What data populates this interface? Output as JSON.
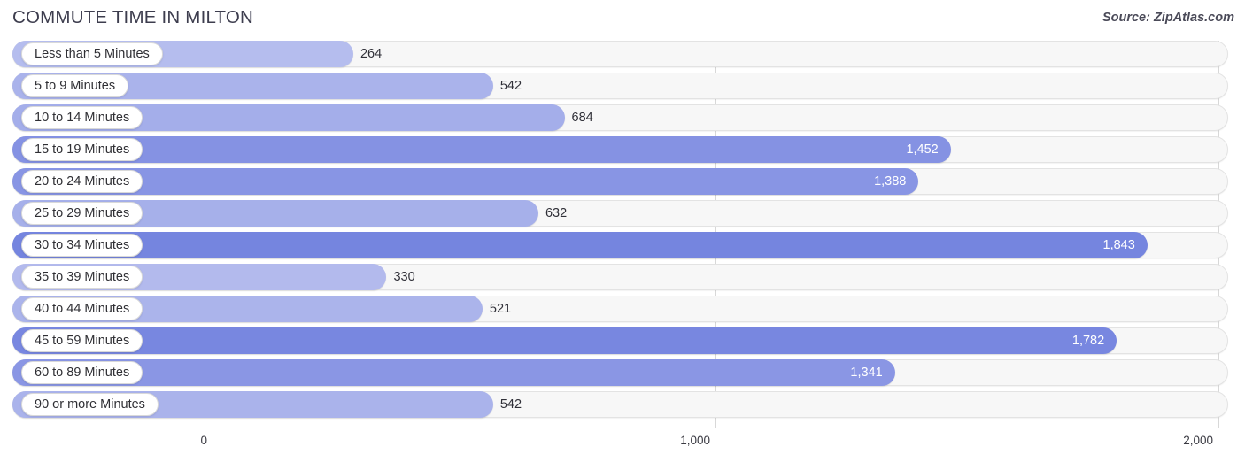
{
  "header": {
    "title": "COMMUTE TIME IN MILTON",
    "source": "Source: ZipAtlas.com"
  },
  "colors": {
    "bar_low": "#b7bfee",
    "bar_high": "#7b8ae0",
    "track": "#f7f7f7",
    "track_border": "#e3e3e3",
    "gridline": "#d8d8d8",
    "title_text": "#3d3d4e",
    "value_text_outside": "#303038",
    "value_text_inside": "#ffffff"
  },
  "axis": {
    "ticks": [
      {
        "label": "0",
        "value": 0
      },
      {
        "label": "1,000",
        "value": 1000
      },
      {
        "label": "2,000",
        "value": 2000
      }
    ],
    "min": 0,
    "max": 2000
  },
  "chart_data": {
    "type": "bar",
    "orientation": "horizontal",
    "title": "COMMUTE TIME IN MILTON",
    "subtitle": "Source: ZipAtlas.com",
    "xlabel": "",
    "ylabel": "",
    "xlim": [
      0,
      2000
    ],
    "grid": true,
    "legend": "none",
    "categories": [
      "Less than 5 Minutes",
      "5 to 9 Minutes",
      "10 to 14 Minutes",
      "15 to 19 Minutes",
      "20 to 24 Minutes",
      "25 to 29 Minutes",
      "30 to 34 Minutes",
      "35 to 39 Minutes",
      "40 to 44 Minutes",
      "45 to 59 Minutes",
      "60 to 89 Minutes",
      "90 or more Minutes"
    ],
    "values": [
      264,
      542,
      684,
      1452,
      1388,
      632,
      1843,
      330,
      521,
      1782,
      1341,
      542
    ],
    "value_labels": [
      "264",
      "542",
      "684",
      "1,452",
      "1,388",
      "632",
      "1,843",
      "330",
      "521",
      "1,782",
      "1,341",
      "542"
    ]
  },
  "rows": [
    {
      "label": "Less than 5 Minutes",
      "value": 264,
      "value_label": "264",
      "inside": false
    },
    {
      "label": "5 to 9 Minutes",
      "value": 542,
      "value_label": "542",
      "inside": false
    },
    {
      "label": "10 to 14 Minutes",
      "value": 684,
      "value_label": "684",
      "inside": false
    },
    {
      "label": "15 to 19 Minutes",
      "value": 1452,
      "value_label": "1,452",
      "inside": true
    },
    {
      "label": "20 to 24 Minutes",
      "value": 1388,
      "value_label": "1,388",
      "inside": true
    },
    {
      "label": "25 to 29 Minutes",
      "value": 632,
      "value_label": "632",
      "inside": false
    },
    {
      "label": "30 to 34 Minutes",
      "value": 1843,
      "value_label": "1,843",
      "inside": true
    },
    {
      "label": "35 to 39 Minutes",
      "value": 330,
      "value_label": "330",
      "inside": false
    },
    {
      "label": "40 to 44 Minutes",
      "value": 521,
      "value_label": "521",
      "inside": false
    },
    {
      "label": "45 to 59 Minutes",
      "value": 1782,
      "value_label": "1,782",
      "inside": true
    },
    {
      "label": "60 to 89 Minutes",
      "value": 1341,
      "value_label": "1,341",
      "inside": true
    },
    {
      "label": "90 or more Minutes",
      "value": 542,
      "value_label": "542",
      "inside": false
    }
  ]
}
